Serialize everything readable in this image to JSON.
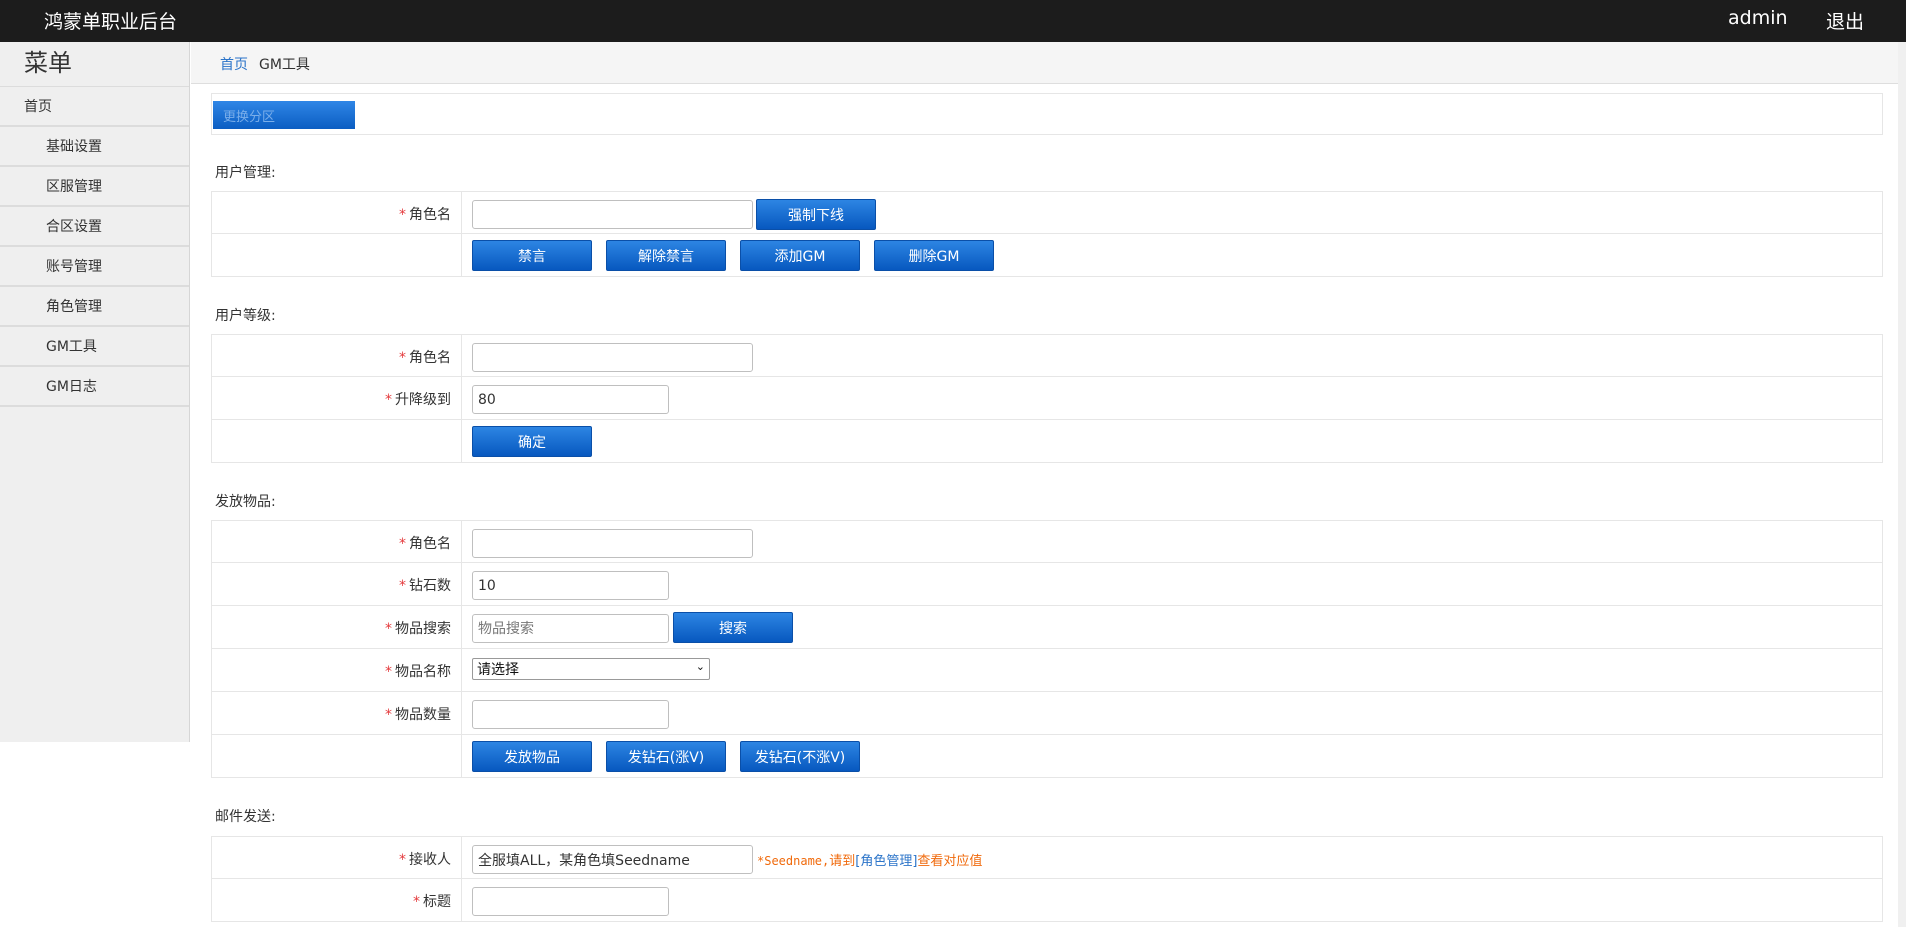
{
  "header": {
    "brand": "鸿蒙单职业后台",
    "user": "admin",
    "logout": "退出"
  },
  "sidebar": {
    "title": "菜单",
    "home": "首页",
    "items": [
      "基础设置",
      "区服管理",
      "合区设置",
      "账号管理",
      "角色管理",
      "GM工具",
      "GM日志"
    ]
  },
  "breadcrumb": {
    "home": "首页",
    "current": "GM工具"
  },
  "zone": {
    "button": "更换分区"
  },
  "user_mgmt": {
    "title": "用户管理:",
    "role_label": "角色名",
    "role_value": "",
    "force_offline": "强制下线",
    "mute": "禁言",
    "unmute": "解除禁言",
    "add_gm": "添加GM",
    "remove_gm": "删除GM"
  },
  "user_level": {
    "title": "用户等级:",
    "role_label": "角色名",
    "role_value": "",
    "level_label": "升降级到",
    "level_value": "80",
    "confirm": "确定"
  },
  "items": {
    "title": "发放物品:",
    "role_label": "角色名",
    "role_value": "",
    "diamond_label": "钻石数",
    "diamond_value": "10",
    "search_label": "物品搜索",
    "search_placeholder": "物品搜索",
    "search_button": "搜索",
    "name_label": "物品名称",
    "name_selected": "请选择",
    "qty_label": "物品数量",
    "qty_value": "",
    "send_items": "发放物品",
    "send_diamond_vip": "发钻石(涨V)",
    "send_diamond_novip": "发钻石(不涨V)"
  },
  "mail": {
    "title": "邮件发送:",
    "recipient_label": "接收人",
    "recipient_value": "全服填ALL，某角色填Seedname",
    "hint_prefix": "*Seedname,",
    "hint_mid": "请到",
    "hint_link": "[角色管理]",
    "hint_suffix": "查看对应值",
    "subject_label": "标题",
    "subject_value": ""
  }
}
